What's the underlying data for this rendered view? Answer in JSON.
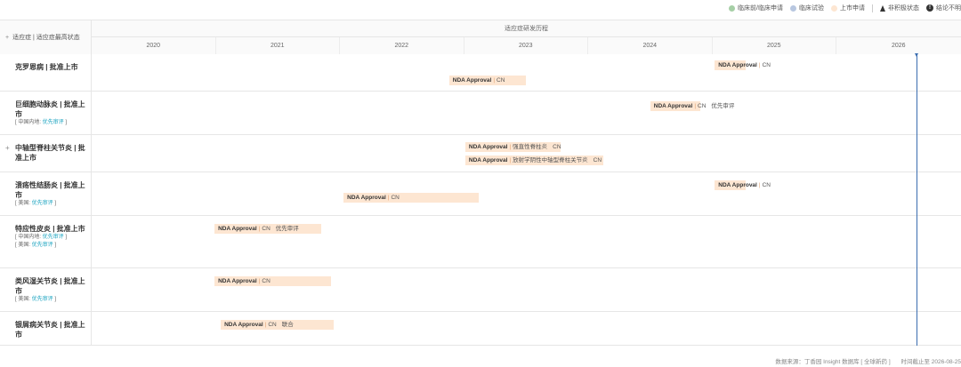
{
  "legend": [
    {
      "label": "临床前/临床申请",
      "color": "#a6cfa6",
      "icon": "dot"
    },
    {
      "label": "临床试验",
      "color": "#b8c7e0",
      "icon": "dot"
    },
    {
      "label": "上市申请",
      "color": "#fde6d2",
      "icon": "dot"
    },
    {
      "label": "非积极状态",
      "icon": "triangle-icon"
    },
    {
      "label": "结论不明",
      "icon": "info-icon"
    }
  ],
  "header": {
    "left_label": "适应症 | 适应症最高状态",
    "title": "适应症研发历程",
    "years": [
      "2020",
      "2021",
      "2022",
      "2023",
      "2024",
      "2025",
      "2026"
    ]
  },
  "rows": [
    {
      "title": "克罗恩病 | 批准上市",
      "notes": [],
      "expand": false,
      "bars": [
        {
          "label": "NDA Approval",
          "region": "CN",
          "detail": "",
          "extra": "",
          "start": 2025.02,
          "end": 2025.27,
          "lane": 0
        },
        {
          "label": "NDA Approval",
          "region": "CN",
          "detail": "",
          "extra": "",
          "start": 2022.88,
          "end": 2023.5,
          "lane": 1
        }
      ]
    },
    {
      "title": "巨细胞动脉炎 | 批准上市",
      "notes": [
        {
          "region": "中国内地:",
          "tag": "优先审评"
        }
      ],
      "expand": false,
      "bars": [
        {
          "label": "NDA Approval",
          "region": "CN",
          "detail": "",
          "extra": "优先审评",
          "start": 2024.5,
          "end": 2024.9,
          "lane": 0
        }
      ]
    },
    {
      "title": "中轴型脊柱关节炎 | 批准上市",
      "notes": [],
      "expand": true,
      "bars": [
        {
          "label": "NDA Approval",
          "region": "",
          "detail": "强直性脊柱炎",
          "extra": "CN",
          "start": 2023.01,
          "end": 2023.78,
          "lane": 0
        },
        {
          "label": "NDA Approval",
          "region": "",
          "detail": "放射学阴性中轴型脊柱关节炎",
          "extra": "CN",
          "start": 2023.01,
          "end": 2024.12,
          "lane": 1
        }
      ]
    },
    {
      "title": "溃疡性结肠炎 | 批准上市",
      "notes": [
        {
          "region": "美国:",
          "tag": "优先审评"
        }
      ],
      "expand": false,
      "bars": [
        {
          "label": "NDA Approval",
          "region": "CN",
          "detail": "",
          "extra": "",
          "start": 2025.02,
          "end": 2025.27,
          "lane": 0
        },
        {
          "label": "NDA Approval",
          "region": "CN",
          "detail": "",
          "extra": "",
          "start": 2022.03,
          "end": 2023.12,
          "lane": 1
        }
      ]
    },
    {
      "title": "特应性皮炎 | 批准上市",
      "notes": [
        {
          "region": "中国内地:",
          "tag": "优先审评"
        },
        {
          "region": "美国:",
          "tag": "优先审评"
        }
      ],
      "expand": false,
      "bars": [
        {
          "label": "NDA Approval",
          "region": "CN",
          "detail": "",
          "extra": "优先审评",
          "start": 2020.99,
          "end": 2021.85,
          "lane": 0
        }
      ]
    },
    {
      "title": "类风湿关节炎 | 批准上市",
      "notes": [
        {
          "region": "美国:",
          "tag": "优先审评"
        }
      ],
      "expand": false,
      "bars": [
        {
          "label": "NDA Approval",
          "region": "CN",
          "detail": "",
          "extra": "",
          "start": 2020.99,
          "end": 2021.93,
          "lane": 0
        }
      ]
    },
    {
      "title": "银屑病关节炎 | 批准上市",
      "notes": [],
      "expand": false,
      "bars": [
        {
          "label": "NDA Approval",
          "region": "CN",
          "detail": "",
          "extra": "联合",
          "start": 2021.04,
          "end": 2021.95,
          "lane": 0
        }
      ]
    }
  ],
  "footer": {
    "source": "数据来源：丁香园 Insight 数据库 [ 全球新药 ]",
    "date": "时间截止至 2026-08-25"
  }
}
